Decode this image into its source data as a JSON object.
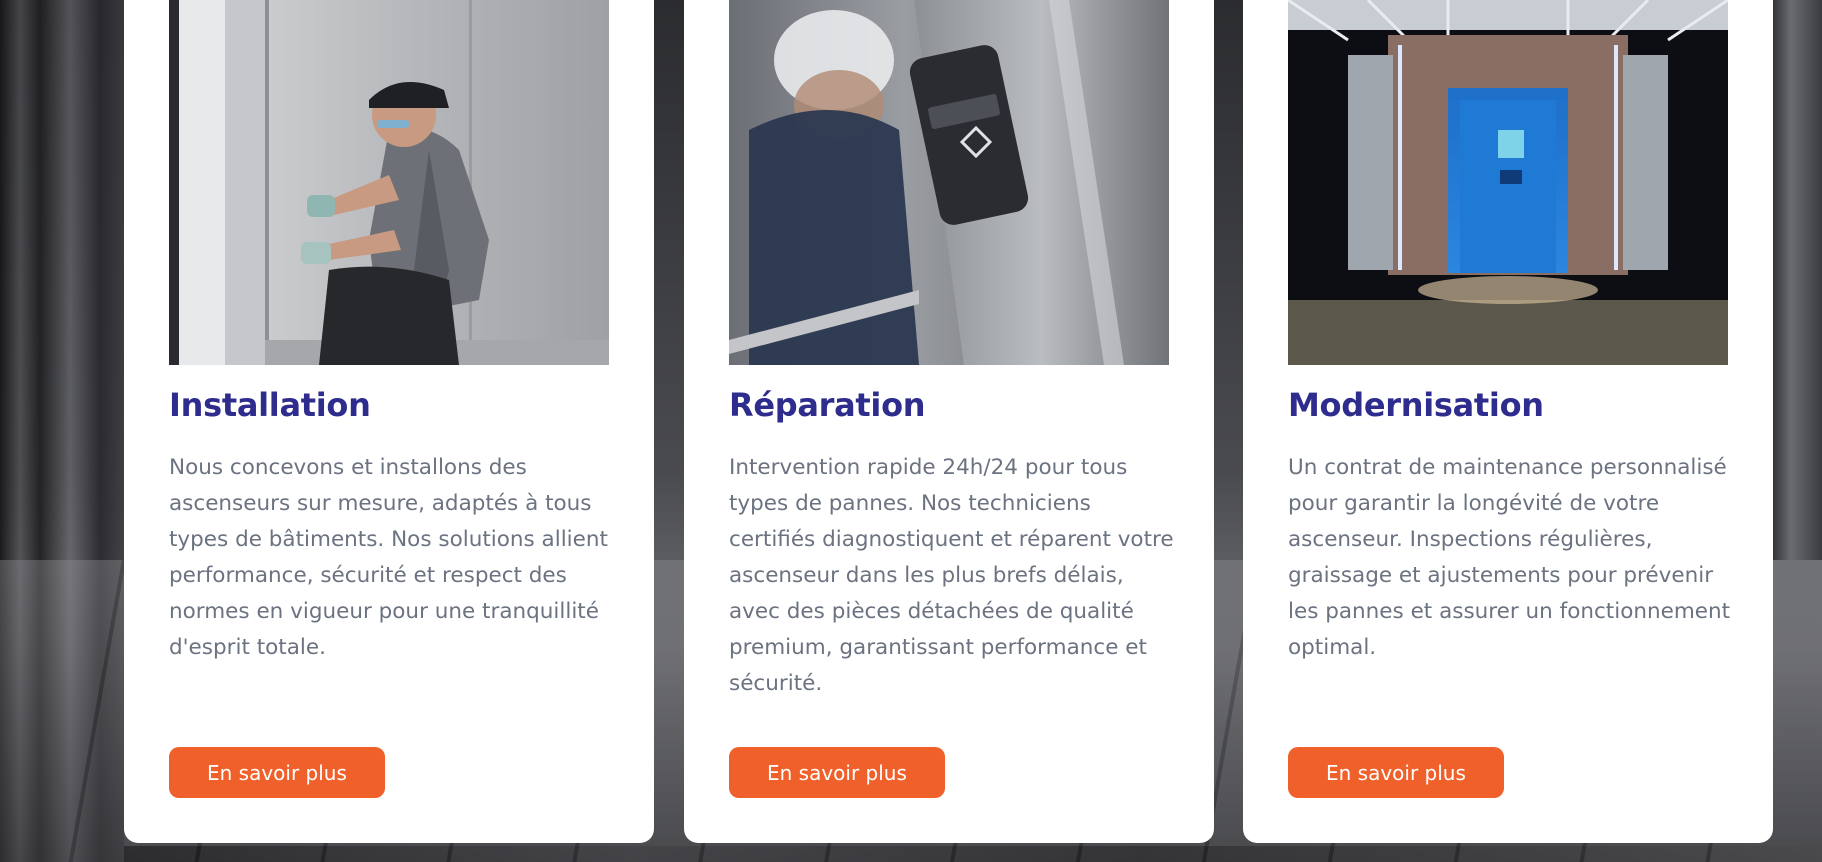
{
  "services": [
    {
      "title": "Installation",
      "description": "Nous concevons et installons des ascenseurs sur mesure, adaptés à tous types de bâtiments. Nos solutions allient performance, sécurité et respect des normes en vigueur pour une tranquillité d'esprit totale.",
      "button_label": "En savoir plus",
      "image": "technician-installing-elevator-photo"
    },
    {
      "title": "Réparation",
      "description": "Intervention rapide 24h/24 pour tous types de pannes. Nos techniciens certifiés diagnostiquent et réparent votre ascenseur dans les plus brefs délais, avec des pièces détachées de qualité premium, garantissant performance et sécurité.",
      "button_label": "En savoir plus",
      "image": "elevator-button-panel-repair-photo"
    },
    {
      "title": "Modernisation",
      "description": "Un contrat de maintenance personnalisé pour garantir la longévité de votre ascenseur. Inspections régulières, graissage et ajustements pour prévenir les pannes et assurer un fonctionnement optimal.",
      "button_label": "En savoir plus",
      "image": "modern-elevator-cabin-night-photo"
    }
  ],
  "colors": {
    "title": "#2e2c8c",
    "text": "#6b7280",
    "button": "#f0602a",
    "card": "#ffffff"
  }
}
